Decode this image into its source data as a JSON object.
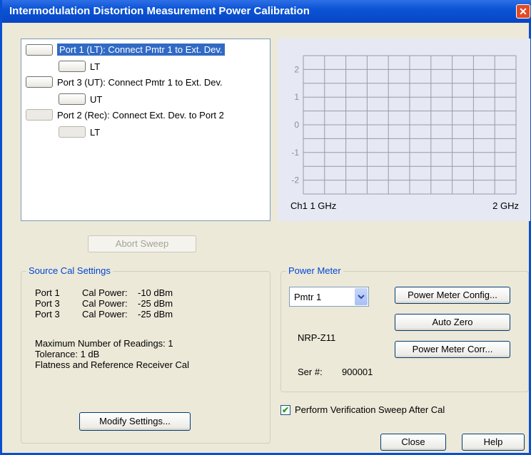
{
  "window": {
    "title": "Intermodulation Distortion Measurement Power Calibration"
  },
  "steps": [
    {
      "label": "Port 1 (LT): Connect Pmtr 1 to Ext. Dev.",
      "sub": "LT",
      "selected": true,
      "enabled": true
    },
    {
      "label": "Port 3 (UT): Connect Pmtr 1 to Ext. Dev.",
      "sub": "UT",
      "selected": false,
      "enabled": true
    },
    {
      "label": "Port 2 (Rec): Connect Ext. Dev. to Port 2",
      "sub": "LT",
      "selected": false,
      "enabled": false
    }
  ],
  "chart": {
    "y_ticks": [
      "2",
      "1",
      "0",
      "-1",
      "-2"
    ],
    "x_start_label": "Ch1 1 GHz",
    "x_end_label": "2 GHz",
    "bg_color": "#e6e8f4",
    "grid_color": "#9a9aa8"
  },
  "abort_sweep_label": "Abort Sweep",
  "source_cal": {
    "title": "Source Cal Settings",
    "rows": [
      {
        "port": "Port 1",
        "cal": "Cal Power:",
        "value": "-10 dBm"
      },
      {
        "port": "Port 3",
        "cal": "Cal Power:",
        "value": "-25 dBm"
      },
      {
        "port": "Port 3",
        "cal": "Cal Power:",
        "value": "-25 dBm"
      }
    ],
    "max_readings": "Maximum Number of Readings: 1",
    "tolerance": "Tolerance: 1 dB",
    "flatness": "Flatness and Reference Receiver Cal",
    "modify_label": "Modify Settings..."
  },
  "power_meter": {
    "title": "Power Meter",
    "selected": "Pmtr 1",
    "config_label": "Power Meter Config...",
    "auto_zero_label": "Auto Zero",
    "corr_label": "Power Meter Corr...",
    "model": "NRP-Z11",
    "ser_label": "Ser #:",
    "ser_value": "900001"
  },
  "verify_label": "Perform Verification Sweep After Cal",
  "close_label": "Close",
  "help_label": "Help"
}
